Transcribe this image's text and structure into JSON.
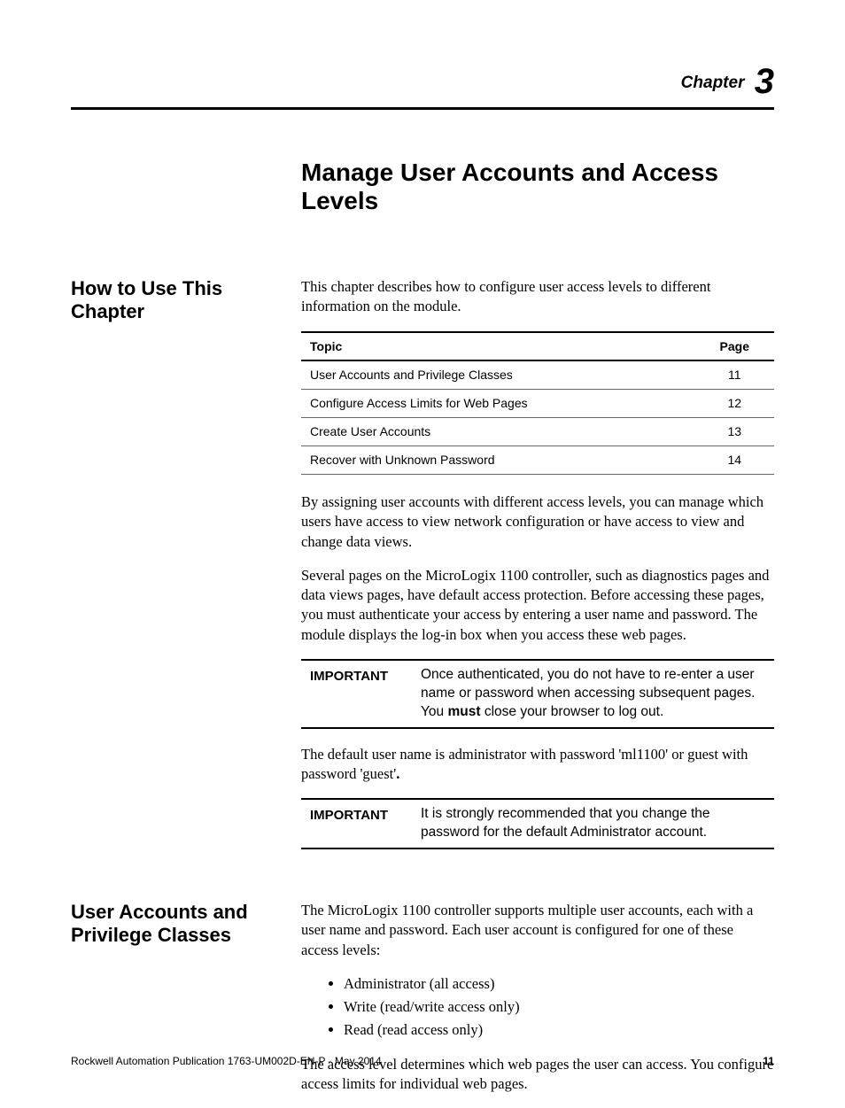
{
  "chapter": {
    "label": "Chapter",
    "number": "3"
  },
  "title": "Manage User Accounts and Access Levels",
  "sections": {
    "howto": {
      "heading": "How to Use This Chapter",
      "intro": "This chapter describes how to configure user access levels to different information on the module.",
      "table": {
        "headers": [
          "Topic",
          "Page"
        ],
        "rows": [
          [
            "User Accounts and Privilege Classes",
            "11"
          ],
          [
            "Configure Access Limits for Web Pages",
            "12"
          ],
          [
            "Create User Accounts",
            "13"
          ],
          [
            "Recover with Unknown Password",
            "14"
          ]
        ]
      },
      "para2": "By assigning user accounts with different access levels, you can manage which users have access to view network configuration or have access to view and change data views.",
      "para3": "Several pages on the MicroLogix 1100 controller, such as diagnostics pages and data views pages, have default access protection. Before accessing these pages, you must authenticate your access by entering a user name and password. The module displays the log-in box when you access these web pages.",
      "important1_label": "IMPORTANT",
      "important1_pre": "Once authenticated, you do not have to re-enter a user name or password when accessing subsequent pages. You ",
      "important1_bold": "must",
      "important1_post": " close your browser to log out.",
      "para4_pre": "The default user name is administrator with password 'ml1100' or guest with password 'guest'",
      "para4_post": ".",
      "important2_label": "IMPORTANT",
      "important2_msg": "It is strongly recommended that you change the password for the default Administrator account."
    },
    "accounts": {
      "heading": "User Accounts and Privilege Classes",
      "intro": "The MicroLogix 1100 controller supports multiple user accounts, each with a user name and password. Each user account is configured for one of these access levels:",
      "bullets": [
        "Administrator (all access)",
        "Write (read/write access only)",
        "Read (read access only)"
      ],
      "para2": "The access level determines which web pages the user can access. You configure access limits for individual web pages."
    }
  },
  "footer": {
    "pub": "Rockwell Automation Publication 1763-UM002D-EN-P - May 2014",
    "page": "11"
  }
}
